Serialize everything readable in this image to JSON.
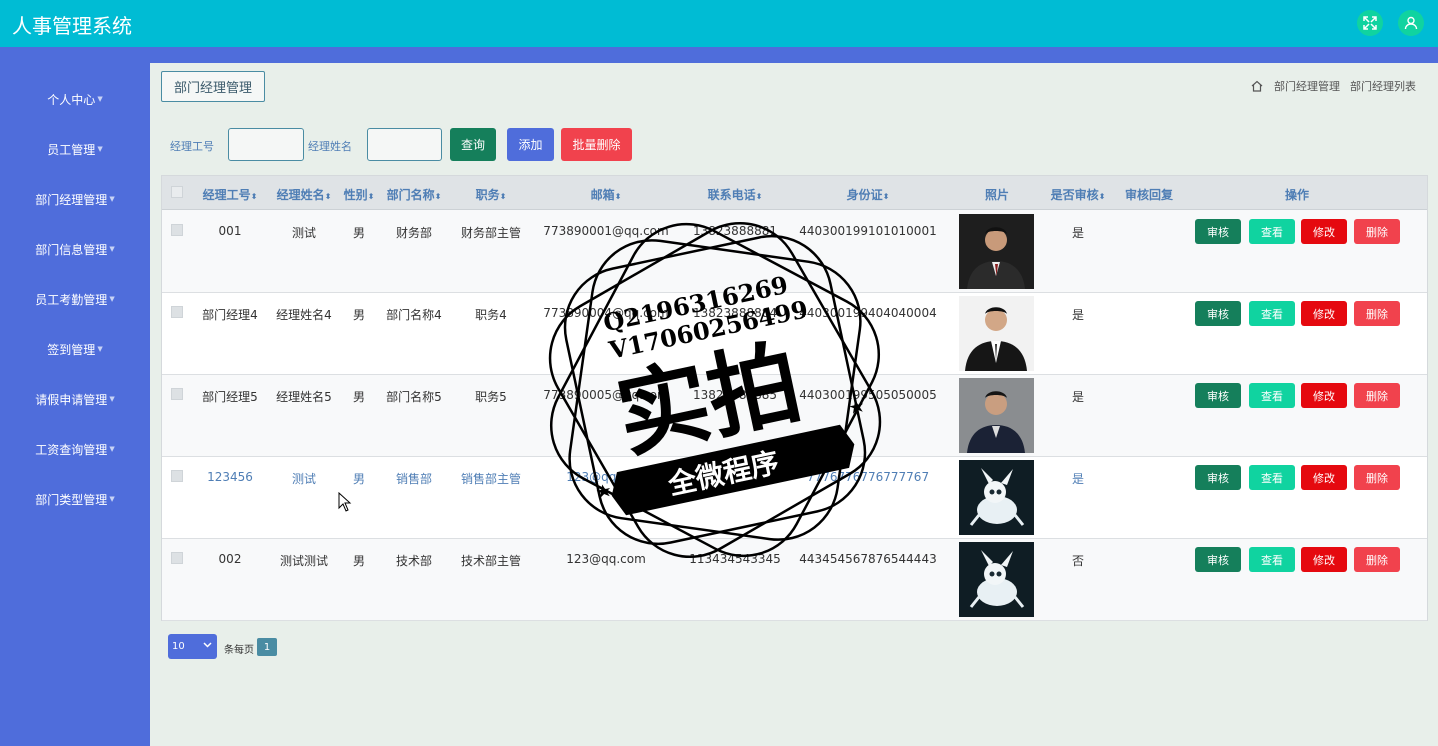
{
  "header": {
    "app_title": "人事管理系统",
    "fullscreen_icon": "fullscreen-icon",
    "user_icon": "user-icon"
  },
  "sidebar": {
    "items": [
      {
        "label": "个人中心"
      },
      {
        "label": "员工管理"
      },
      {
        "label": "部门经理管理"
      },
      {
        "label": "部门信息管理"
      },
      {
        "label": "员工考勤管理"
      },
      {
        "label": "签到管理"
      },
      {
        "label": "请假申请管理"
      },
      {
        "label": "工资查询管理"
      },
      {
        "label": "部门类型管理"
      }
    ]
  },
  "page": {
    "tab_label": "部门经理管理",
    "breadcrumb": [
      "部门经理管理",
      "部门经理列表"
    ]
  },
  "search": {
    "field1_label": "经理工号",
    "field1_value": "",
    "field2_label": "经理姓名",
    "field2_value": "",
    "query_label": "查询",
    "add_label": "添加",
    "batch_delete_label": "批量删除"
  },
  "table": {
    "headers": [
      "经理工号",
      "经理姓名",
      "性别",
      "部门名称",
      "职务",
      "邮箱",
      "联系电话",
      "身份证",
      "照片",
      "是否审核",
      "审核回复",
      "操作"
    ],
    "rows": [
      {
        "id": "001",
        "name": "测试",
        "gender": "男",
        "dept": "财务部",
        "position": "财务部主管",
        "email": "773890001@qq.com",
        "phone": "13823888881",
        "idcard": "440300199101010001",
        "audited": "是",
        "reply": ""
      },
      {
        "id": "部门经理4",
        "name": "经理姓名4",
        "gender": "男",
        "dept": "部门名称4",
        "position": "职务4",
        "email": "773890004@qq.com",
        "phone": "13823888884",
        "idcard": "440300199404040004",
        "audited": "是",
        "reply": ""
      },
      {
        "id": "部门经理5",
        "name": "经理姓名5",
        "gender": "男",
        "dept": "部门名称5",
        "position": "职务5",
        "email": "773890005@qq.com",
        "phone": "13823888885",
        "idcard": "440300199505050005",
        "audited": "是",
        "reply": ""
      },
      {
        "id": "123456",
        "name": "测试",
        "gender": "男",
        "dept": "销售部",
        "position": "销售部主管",
        "email": "123@qq.com",
        "phone": "",
        "idcard": "7776776776777767",
        "audited": "是",
        "reply": ""
      },
      {
        "id": "002",
        "name": "测试测试",
        "gender": "男",
        "dept": "技术部",
        "position": "技术部主管",
        "email": "123@qq.com",
        "phone": "113434543345",
        "idcard": "443454567876544443",
        "audited": "否",
        "reply": ""
      }
    ],
    "actions": {
      "audit": "审核",
      "view": "查看",
      "edit": "修改",
      "delete": "删除"
    }
  },
  "pagination": {
    "page_size": "10",
    "per_page_label": "条每页",
    "current_page": "1"
  },
  "watermark": {
    "line1": "Q2196316269",
    "line2": "V17060256499",
    "big": "实拍",
    "ribbon": "全微程序"
  },
  "colors": {
    "topbar": "#00bcd4",
    "sidebar": "#4f6ddb",
    "audit": "#157f5b",
    "view": "#10d3a0",
    "edit": "#e5090f",
    "delete": "#f1424d"
  }
}
